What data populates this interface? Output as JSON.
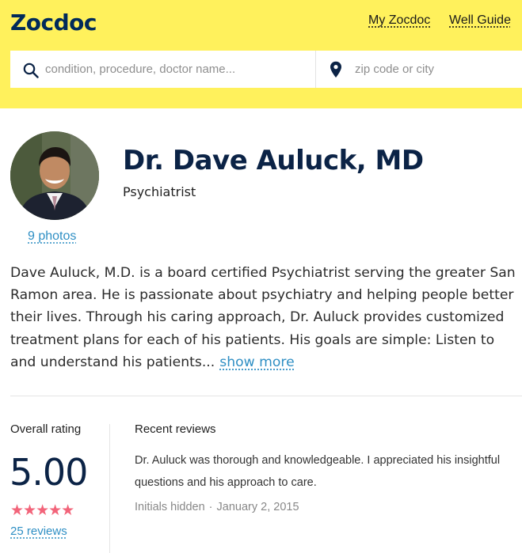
{
  "header": {
    "logo": "Zocdoc",
    "nav": {
      "my_zocdoc": "My Zocdoc",
      "well_guide": "Well Guide"
    },
    "search": {
      "query_placeholder": "condition, procedure, doctor name...",
      "query_value": "",
      "zip_placeholder": "zip code or city",
      "zip_value": "",
      "query_icon": "search-icon",
      "zip_icon": "map-pin-icon"
    },
    "colors": {
      "background": "#fff15c",
      "logo": "#002a5a"
    }
  },
  "profile": {
    "name": "Dr. Dave Auluck, MD",
    "specialty": "Psychiatrist",
    "photos_link": "9 photos",
    "bio": "Dave Auluck, M.D. is a board certified Psychiatrist serving the greater San Ramon area. He is passionate about psychiatry and helping people better their lives. Through his caring approach, Dr. Auluck provides customized treatment plans for each of his patients. His goals are simple: Listen to and understand his patients...",
    "show_more": "show more"
  },
  "ratings": {
    "label": "Overall rating",
    "value": "5.00",
    "stars": "★★★★★",
    "star_count": 5,
    "reviews_link": "25 reviews",
    "star_color": "#f2647a"
  },
  "recent_reviews": {
    "label": "Recent reviews",
    "items": [
      {
        "text": "Dr. Auluck was thorough and knowledgeable. I appreciated his insightful questions and his approach to care.",
        "author": "Initials hidden",
        "separator": "·",
        "date": "January 2, 2015"
      }
    ]
  },
  "link_color": "#2f8fc4"
}
